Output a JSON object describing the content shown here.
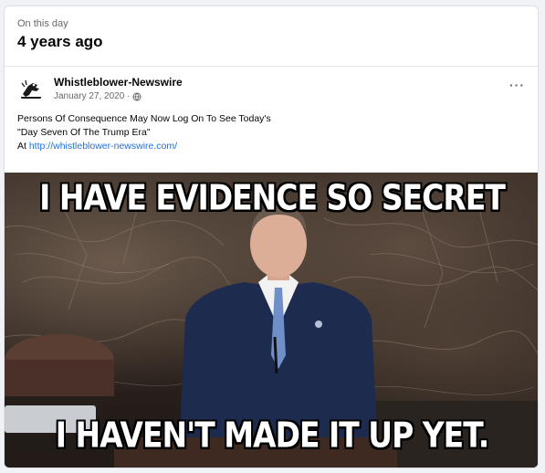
{
  "memory": {
    "label": "On this day",
    "ago": "4 years ago"
  },
  "post": {
    "author": "Whistleblower-Newswire",
    "date": "January 27, 2020 ·",
    "text_line1": "Persons Of Consequence May Now Log On To See Today's",
    "text_line2": "\"Day Seven Of The Trump Era\"",
    "text_line3_prefix": "At ",
    "link": "http://whistleblower-newswire.com/",
    "more_label": "···"
  },
  "image": {
    "caption_top": "I HAVE EVIDENCE SO SECRET",
    "caption_bottom": "I HAVEN'T MADE IT UP YET."
  },
  "colors": {
    "link": "#216fdb",
    "background": "#f0f2f5",
    "suit": "#1d2b4f",
    "tie": "#6f8fc9"
  }
}
